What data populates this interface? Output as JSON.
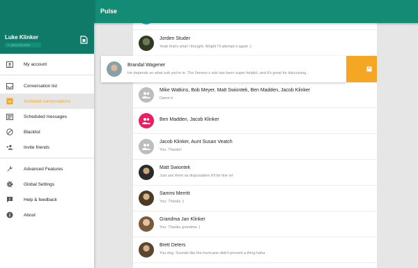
{
  "app": {
    "title": "Pulse"
  },
  "drawer": {
    "user_name": "Luke Klinker",
    "phone": "+1 (555) 555-5555",
    "sim_icon": "sim-card-icon",
    "items": [
      {
        "label": "My account",
        "icon": "account-icon",
        "active": false
      },
      {
        "label": "Conversation list",
        "icon": "inbox-icon",
        "active": false
      },
      {
        "label": "Archived conversations",
        "icon": "archive-icon",
        "active": true
      },
      {
        "label": "Scheduled messages",
        "icon": "schedule-icon",
        "active": false
      },
      {
        "label": "Blacklist",
        "icon": "block-icon",
        "active": false
      },
      {
        "label": "Invite friends",
        "icon": "invite-icon",
        "active": false
      },
      {
        "label": "Advanced Features",
        "icon": "wrench-icon",
        "active": false
      },
      {
        "label": "Global Settings",
        "icon": "gear-icon",
        "active": false
      },
      {
        "label": "Help & feedback",
        "icon": "feedback-icon",
        "active": false
      },
      {
        "label": "About",
        "icon": "info-icon",
        "active": false
      }
    ]
  },
  "conversations": [
    {
      "name": "Jorden Studer",
      "snippet": "Yeah that's what I thought. Alright I'll attempt it again :)"
    },
    {
      "name": "Mike Watkins, Bob Meyer, Matt Swiontek, Ben Madden, Jacob Klinker",
      "snippet": "Damn it"
    },
    {
      "name": "Ben Madden, Jacob Klinker",
      "snippet": ""
    },
    {
      "name": "Jacob Klinker, Aunt Susan Veatch",
      "snippet": "You: Thanks!"
    },
    {
      "name": "Matt Swiontek",
      "snippet": "Just use them as disposables it'll be fine lol"
    },
    {
      "name": "Sammi Merritt",
      "snippet": "You: Thanks :)"
    },
    {
      "name": "Grandma Jan Klinker",
      "snippet": "You: Thanks grandma :)"
    },
    {
      "name": "Brett Deters",
      "snippet": "You dog. Sounds like the hurricane didn't prevent a thing haha"
    }
  ],
  "swiped_conversation": {
    "name": "Brandal Wagener",
    "snippet": "He depends on what sub you're in. The /lenovo x sub has been super helpful, and it's great for discussing...",
    "action_icon": "archive-icon"
  },
  "colors": {
    "primary": "#128c74",
    "primary_dark": "#0f7a67",
    "accent": "#f5a623",
    "group_pink": "#e91e63"
  }
}
